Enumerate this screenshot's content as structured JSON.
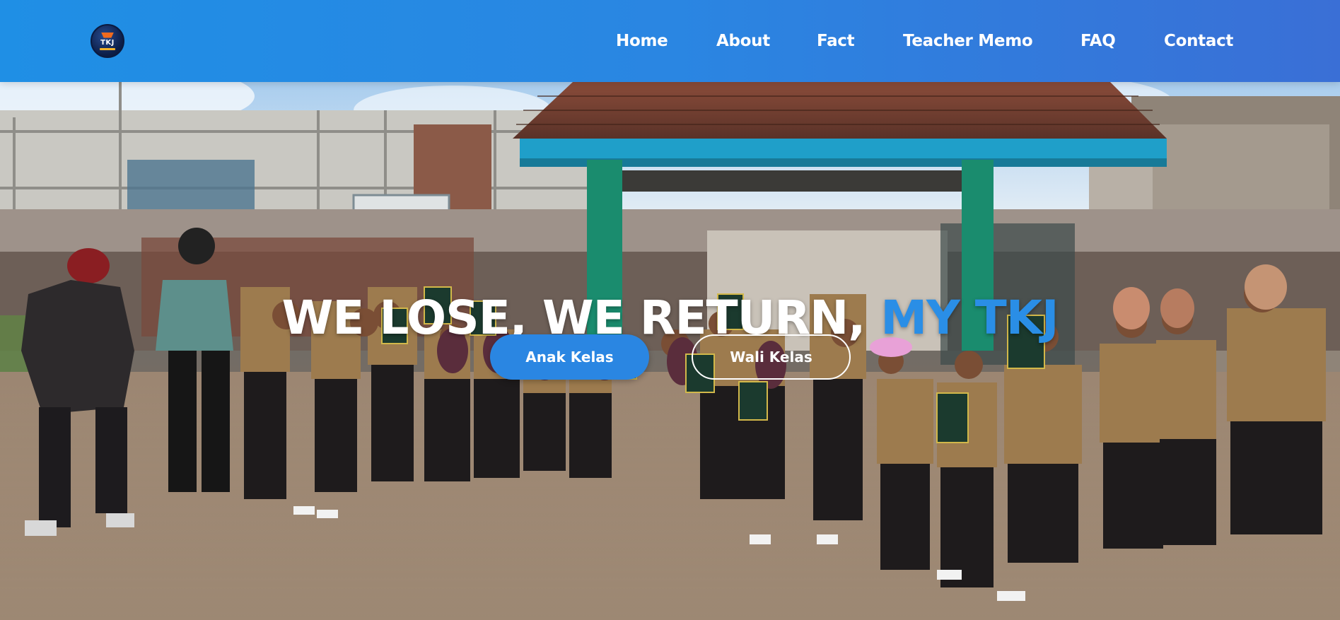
{
  "navbar": {
    "logo": {
      "icon": "tkj-logo-icon",
      "text": "TKJ"
    },
    "items": [
      {
        "label": "Home"
      },
      {
        "label": "About"
      },
      {
        "label": "Fact"
      },
      {
        "label": "Teacher Memo"
      },
      {
        "label": "FAQ"
      },
      {
        "label": "Contact"
      }
    ]
  },
  "hero": {
    "title_main": "WE LOSE, WE RETURN,",
    "title_accent": "MY TKJ",
    "buttons": {
      "primary": "Anak Kelas",
      "secondary": "Wali Kelas"
    }
  },
  "colors": {
    "nav_start": "#1f8fe5",
    "nav_end": "#3a6fd6",
    "accent": "#2a8ee6",
    "button_primary": "#2a86e2",
    "text_light": "#ffffff"
  }
}
